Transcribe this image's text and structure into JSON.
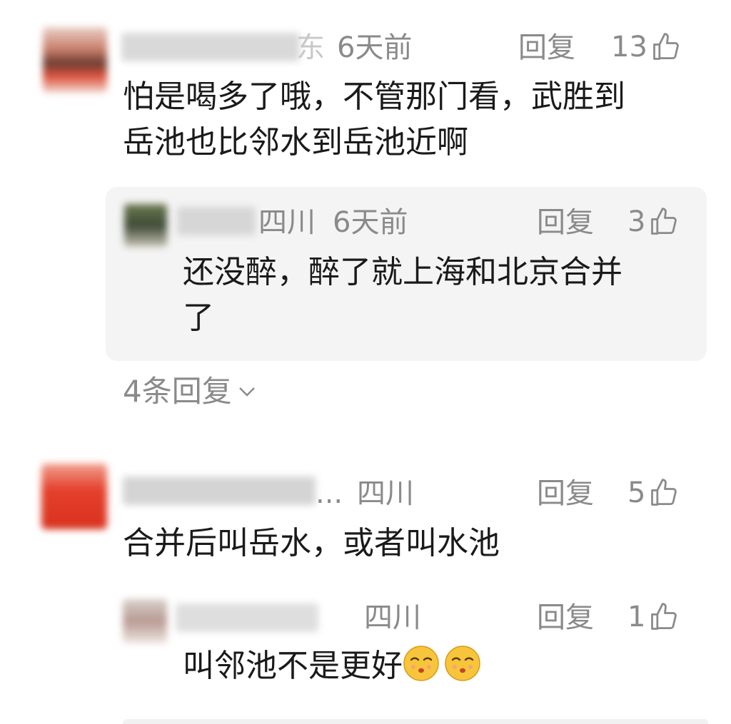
{
  "comments": [
    {
      "location": "东",
      "time": "6天前",
      "reply_label": "回复",
      "likes": "13",
      "text_lines": [
        "怕是喝多了哦，不管那门看，武胜到",
        "岳池也比邻水到岳池近啊"
      ],
      "replies": [
        {
          "location": "四川",
          "time": "6天前",
          "reply_label": "回复",
          "likes": "3",
          "text_lines": [
            "还没醉，醉了就上海和北京合并",
            "了"
          ]
        }
      ],
      "more_replies": "4条回复"
    },
    {
      "name_tail": "...",
      "location": "四川",
      "reply_label": "回复",
      "likes": "5",
      "text": "合并后叫岳水，或者叫水池",
      "replies": [
        {
          "location": "四川",
          "reply_label": "回复",
          "likes": "1",
          "text": "叫邻池不是更好"
        }
      ]
    }
  ],
  "icons": {
    "like": "thumbs-up-icon",
    "expand": "chevron-down-icon",
    "emoji": "shushing-face-emoji"
  },
  "colors": {
    "meta_text": "#8a8a8a",
    "reply_bg": "#f4f4f4"
  }
}
